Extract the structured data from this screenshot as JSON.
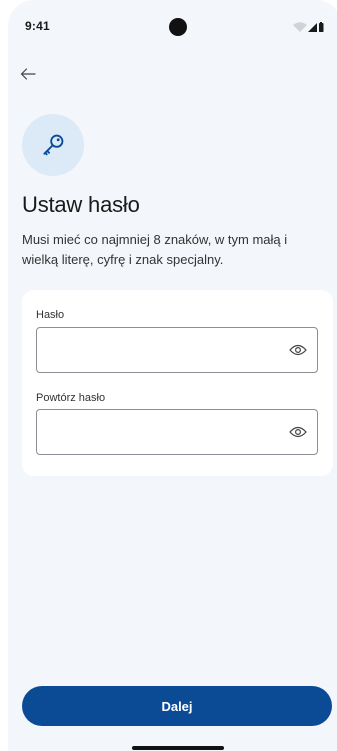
{
  "status_bar": {
    "time": "9:41",
    "icons": [
      "wifi-icon",
      "signal-icon",
      "battery-icon"
    ]
  },
  "header": {
    "back_icon": "arrow-left-icon",
    "badge_icon": "key-icon"
  },
  "page": {
    "title": "Ustaw hasło",
    "description": "Musi mieć co najmniej 8 znaków, w tym małą i wielką literę, cyfrę i znak specjalny."
  },
  "form": {
    "password": {
      "label": "Hasło",
      "value": "",
      "placeholder": "",
      "toggle_icon": "eye-icon"
    },
    "repeat_password": {
      "label": "Powtórz hasło",
      "value": "",
      "placeholder": "",
      "toggle_icon": "eye-icon"
    }
  },
  "actions": {
    "next_label": "Dalej"
  },
  "colors": {
    "background": "#f3f6fb",
    "card": "#ffffff",
    "accent": "#0b4a95",
    "badge_background": "#dce9f7",
    "input_border": "#8a8f96"
  }
}
